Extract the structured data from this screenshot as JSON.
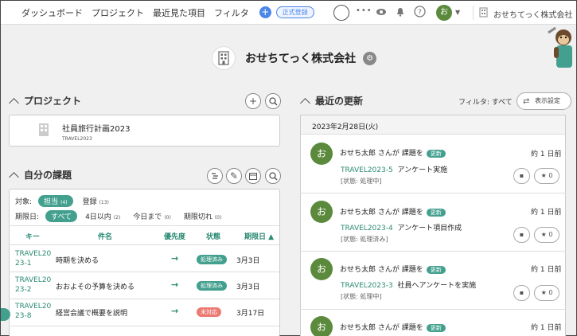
{
  "nav": {
    "items": [
      "ダッシュボード",
      "プロジェクト",
      "最近見た項目",
      "フィルタ"
    ],
    "plus_label": "+",
    "plan_label": "正式登録",
    "more_icon": "•••",
    "user_initial": "お",
    "org_name": "おせちてっく株式会社"
  },
  "org": {
    "title": "おせちてっく株式会社"
  },
  "projects": {
    "title": "プロジェクト",
    "items": [
      {
        "name": "社員旅行計画2023",
        "key": "TRAVEL2023"
      }
    ]
  },
  "my_tasks": {
    "title": "自分の課題",
    "filter_target_label": "対象:",
    "assigned_label": "担当",
    "assigned_count": "(4)",
    "registered_label": "登録",
    "registered_count": "(13)",
    "due_label": "期限日:",
    "due_filters": [
      {
        "label": "すべて",
        "count": ""
      },
      {
        "label": "4日以内",
        "count": "(2)"
      },
      {
        "label": "今日まで",
        "count": "(0)"
      },
      {
        "label": "期限切れ",
        "count": "(0)"
      }
    ],
    "columns": [
      "キー",
      "件名",
      "優先度",
      "状態",
      "期限日 ▲"
    ],
    "rows": [
      {
        "key": "TRAVEL2023-1",
        "name": "時期を決める",
        "priority": "→",
        "status": "処理済み",
        "status_color": "#43a08e",
        "due": "3月3日"
      },
      {
        "key": "TRAVEL2023-2",
        "name": "おおよその予算を決める",
        "priority": "→",
        "status": "処理済み",
        "status_color": "#43a08e",
        "due": "3月3日"
      },
      {
        "key": "TRAVEL2023-8",
        "name": "経営会議で概要を説明",
        "priority": "→",
        "status": "未対応",
        "status_color": "#ec7a72",
        "due": "3月17日"
      }
    ]
  },
  "updates": {
    "title": "最近の更新",
    "filter_text": "フィルタ: すべて",
    "display_settings": "表示設定",
    "date_header": "2023年2月28日(火)",
    "items": [
      {
        "actor": "おせち太郎 さんが 課題を",
        "badge": "更新",
        "key": "TRAVEL2023-5",
        "summary": "アンケート実施",
        "status": "[状態: 処理中]",
        "time": "約 1 日前",
        "likes": "0"
      },
      {
        "actor": "おせち太郎 さんが 課題を",
        "badge": "更新",
        "key": "TRAVEL2023-4",
        "summary": "アンケート項目作成",
        "status": "[状態: 処理済み]",
        "time": "約 1 日前",
        "likes": "0"
      },
      {
        "actor": "おせち太郎 さんが 課題を",
        "badge": "更新",
        "key": "TRAVEL2023-3",
        "summary": "社員へアンケートを実施",
        "status": "[状態: 処理中]",
        "time": "約 1 日前",
        "likes": "0"
      },
      {
        "actor": "おせち太郎 さんが 課題を",
        "badge": "更新",
        "key": "",
        "summary": "",
        "status": "",
        "time": "約 1 日前",
        "likes": ""
      }
    ]
  },
  "colors": {
    "accent": "#43a08e",
    "link": "#2a8a72",
    "alert": "#ec7a72",
    "avatar": "#5b8a3c",
    "brand_blue": "#4a86e8"
  }
}
